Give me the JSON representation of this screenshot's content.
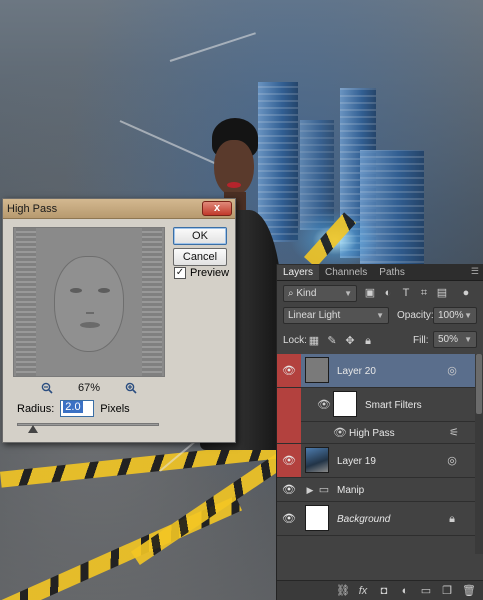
{
  "dialog": {
    "title": "High Pass",
    "close_label": "x",
    "ok_label": "OK",
    "cancel_label": "Cancel",
    "preview_label": "Preview",
    "preview_checked": true,
    "zoom_out_icon": "zoom-out-icon",
    "zoom_in_icon": "zoom-in-icon",
    "zoom_level": "67%",
    "radius_label": "Radius:",
    "radius_value": "2.0",
    "radius_unit": "Pixels"
  },
  "layers_panel": {
    "tabs": [
      "Layers",
      "Channels",
      "Paths"
    ],
    "filter_kind": "Kind",
    "blend_mode": "Linear Light",
    "opacity_label": "Opacity:",
    "opacity_value": "100%",
    "lock_label": "Lock:",
    "fill_label": "Fill:",
    "fill_value": "50%",
    "layers": [
      {
        "name": "Layer 20",
        "selected": true
      },
      {
        "name": "Smart Filters"
      },
      {
        "name": "High Pass"
      },
      {
        "name": "Layer 19"
      },
      {
        "name": "Manip"
      },
      {
        "name": "Background",
        "locked": true
      }
    ]
  },
  "colors": {
    "selection": "#5a6e8c",
    "eye_highlight": "#b3413e",
    "dialog_title": "#c4a77c"
  }
}
